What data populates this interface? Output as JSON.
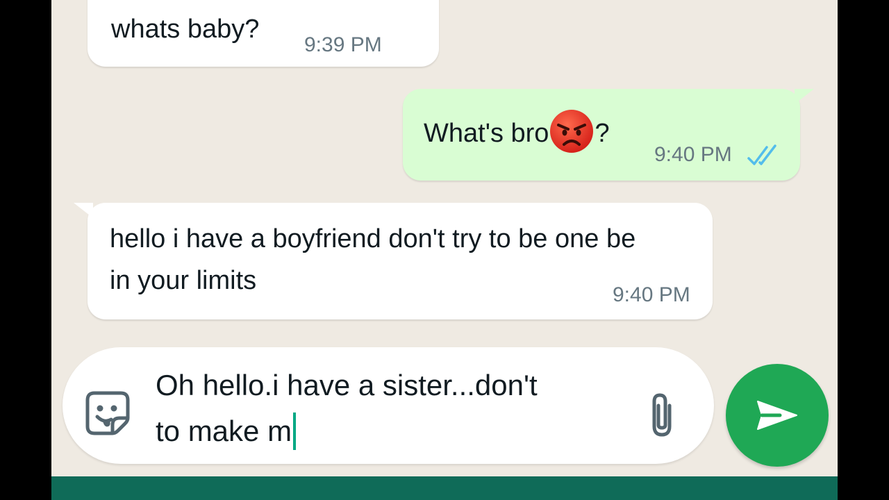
{
  "chat": {
    "messages": [
      {
        "direction": "incoming",
        "text": "whats baby?",
        "time": "9:39 PM"
      },
      {
        "direction": "outgoing",
        "text_before": "What's bro",
        "emoji": "angry-face-emoji",
        "text_after": "?",
        "time": "9:40 PM",
        "status": "read-double-check"
      },
      {
        "direction": "incoming",
        "lines": [
          "hello i have a boyfriend don't try to be one be",
          "in your limits"
        ],
        "time": "9:40 PM"
      }
    ]
  },
  "composer": {
    "lines": [
      "Oh hello.i have a sister...don't",
      "to make m"
    ],
    "sticker_icon": "sticker-icon",
    "attach_icon": "paperclip-icon",
    "send_icon": "send-arrow-icon"
  },
  "colors": {
    "chat_background": "#efeae2",
    "outgoing_bubble": "#d9fdd3",
    "incoming_bubble": "#ffffff",
    "send_button": "#1fa855",
    "read_ticks": "#53bdeb",
    "bottom_bar": "#0f6b58"
  }
}
